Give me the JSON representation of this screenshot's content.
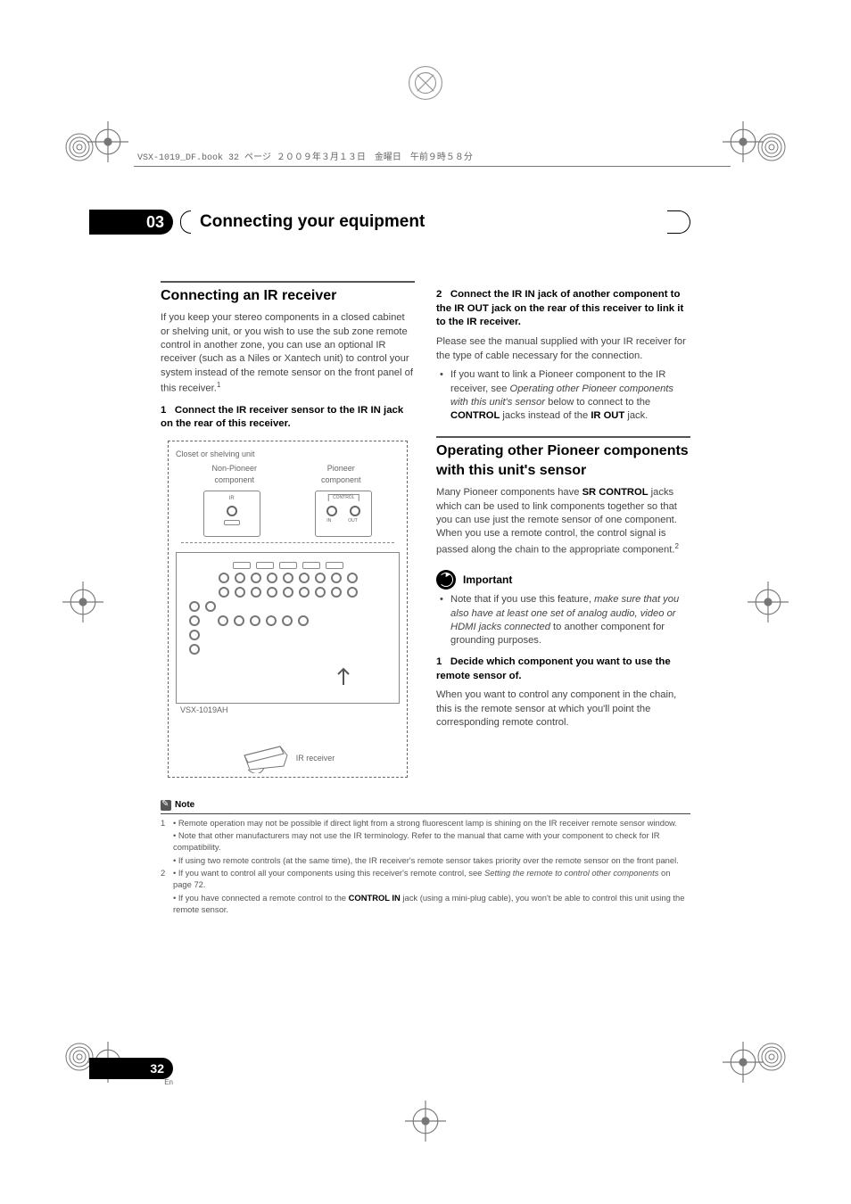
{
  "imposition": {
    "left": "VSX-1019_DF.book  32 ページ  ２００９年３月１３日　金曜日　午前９時５８分",
    "right": ""
  },
  "chapter": {
    "number": "03",
    "title": "Connecting your equipment"
  },
  "left_col": {
    "section_title": "Connecting an IR receiver",
    "intro": "If you keep your stereo components in a closed cabinet or shelving unit, or you wish to use the sub zone remote control in another zone, you can use an optional IR receiver (such as a Niles or Xantech unit) to control your system instead of the remote sensor on the front panel of this receiver.",
    "intro_sup": "1",
    "step1_head_num": "1",
    "step1_head_text": "Connect the IR receiver sensor to the IR IN jack on the rear of this receiver.",
    "diagram": {
      "closet_label": "Closet or shelving unit",
      "nonpioneer": "Non-Pioneer component",
      "pioneer": "Pioneer component",
      "control_label": "CONTROL",
      "in_label": "IN",
      "out_label": "OUT",
      "ir_label": "IR",
      "model": "VSX-1019AH",
      "ir_receiver": "IR receiver"
    }
  },
  "right_col": {
    "step2_head_num": "2",
    "step2_head_text": "Connect the IR IN jack of another component to the IR OUT jack on the rear of this receiver to link it to the IR receiver.",
    "step2_body": "Please see the manual supplied with your IR receiver for the type of cable necessary for the connection.",
    "step2_bullet_pre": "If you want to link a Pioneer component to the IR receiver, see ",
    "step2_bullet_em": "Operating other Pioneer components with this unit's sensor",
    "step2_bullet_mid": " below to connect to the ",
    "step2_bullet_bold1": "CONTROL",
    "step2_bullet_mid2": " jacks instead of the ",
    "step2_bullet_bold2": "IR OUT",
    "step2_bullet_end": " jack.",
    "section2_title": "Operating other Pioneer components with this unit's sensor",
    "section2_intro_pre": "Many Pioneer components have ",
    "section2_intro_bold": "SR CONTROL",
    "section2_intro_post": " jacks which can be used to link components together so that you can use just the remote sensor of one component. When you use a remote control, the control signal is passed along the chain to the appropriate component.",
    "section2_intro_sup": "2",
    "important_label": "Important",
    "important_bullet_pre": "Note that if you use this feature, ",
    "important_bullet_em": "make sure that you also have at least one set of analog audio, video or HDMI jacks connected",
    "important_bullet_post": " to another component for grounding purposes.",
    "s2_step1_num": "1",
    "s2_step1_head": "Decide which component you want to use the remote sensor of.",
    "s2_step1_body": "When you want to control any component in the chain, this is the remote sensor at which you'll point the corresponding remote control."
  },
  "notes": {
    "label": "Note",
    "items": [
      {
        "num": "1",
        "bullets": [
          "Remote operation may not be possible if direct light from a strong fluorescent lamp is shining on the IR receiver remote sensor window.",
          "Note that other manufacturers may not use the IR terminology. Refer to the manual that came with your component to check for IR compatibility.",
          "If using two remote controls (at the same time), the IR receiver's remote sensor takes priority over the remote sensor on the front panel."
        ]
      },
      {
        "num": "2",
        "bullets": [
          "If you want to control all your components using this receiver's remote control, see <i>Setting the remote to control other components</i> on page 72.",
          "If you have connected a remote control to the <b>CONTROL IN</b> jack (using a mini-plug cable), you won't be able to control this unit using the remote sensor."
        ]
      }
    ]
  },
  "page": {
    "number": "32",
    "lang": "En"
  }
}
